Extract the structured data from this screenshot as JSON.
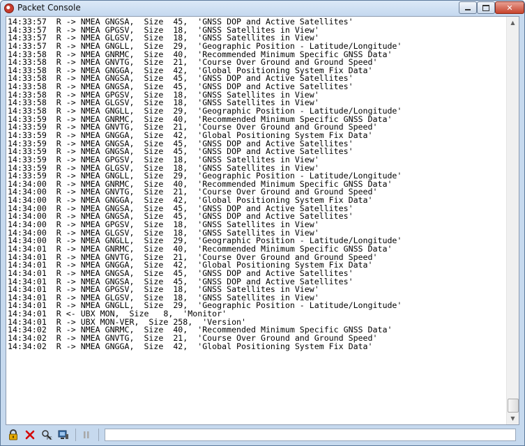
{
  "window": {
    "title": "Packet Console",
    "minimize_label": "",
    "maximize_label": "",
    "close_label": "✕"
  },
  "log": [
    "14:33:57  R -> NMEA GNGSA,  Size  45,  'GNSS DOP and Active Satellites'",
    "14:33:57  R -> NMEA GPGSV,  Size  18,  'GNSS Satellites in View'",
    "14:33:57  R -> NMEA GLGSV,  Size  18,  'GNSS Satellites in View'",
    "14:33:57  R -> NMEA GNGLL,  Size  29,  'Geographic Position - Latitude/Longitude'",
    "14:33:58  R -> NMEA GNRMC,  Size  40,  'Recommended Minimum Specific GNSS Data'",
    "14:33:58  R -> NMEA GNVTG,  Size  21,  'Course Over Ground and Ground Speed'",
    "14:33:58  R -> NMEA GNGGA,  Size  42,  'Global Positioning System Fix Data'",
    "14:33:58  R -> NMEA GNGSA,  Size  45,  'GNSS DOP and Active Satellites'",
    "14:33:58  R -> NMEA GNGSA,  Size  45,  'GNSS DOP and Active Satellites'",
    "14:33:58  R -> NMEA GPGSV,  Size  18,  'GNSS Satellites in View'",
    "14:33:58  R -> NMEA GLGSV,  Size  18,  'GNSS Satellites in View'",
    "14:33:58  R -> NMEA GNGLL,  Size  29,  'Geographic Position - Latitude/Longitude'",
    "14:33:59  R -> NMEA GNRMC,  Size  40,  'Recommended Minimum Specific GNSS Data'",
    "14:33:59  R -> NMEA GNVTG,  Size  21,  'Course Over Ground and Ground Speed'",
    "14:33:59  R -> NMEA GNGGA,  Size  42,  'Global Positioning System Fix Data'",
    "14:33:59  R -> NMEA GNGSA,  Size  45,  'GNSS DOP and Active Satellites'",
    "14:33:59  R -> NMEA GNGSA,  Size  45,  'GNSS DOP and Active Satellites'",
    "14:33:59  R -> NMEA GPGSV,  Size  18,  'GNSS Satellites in View'",
    "14:33:59  R -> NMEA GLGSV,  Size  18,  'GNSS Satellites in View'",
    "14:33:59  R -> NMEA GNGLL,  Size  29,  'Geographic Position - Latitude/Longitude'",
    "14:34:00  R -> NMEA GNRMC,  Size  40,  'Recommended Minimum Specific GNSS Data'",
    "14:34:00  R -> NMEA GNVTG,  Size  21,  'Course Over Ground and Ground Speed'",
    "14:34:00  R -> NMEA GNGGA,  Size  42,  'Global Positioning System Fix Data'",
    "14:34:00  R -> NMEA GNGSA,  Size  45,  'GNSS DOP and Active Satellites'",
    "14:34:00  R -> NMEA GNGSA,  Size  45,  'GNSS DOP and Active Satellites'",
    "14:34:00  R -> NMEA GPGSV,  Size  18,  'GNSS Satellites in View'",
    "14:34:00  R -> NMEA GLGSV,  Size  18,  'GNSS Satellites in View'",
    "14:34:00  R -> NMEA GNGLL,  Size  29,  'Geographic Position - Latitude/Longitude'",
    "14:34:01  R -> NMEA GNRMC,  Size  40,  'Recommended Minimum Specific GNSS Data'",
    "14:34:01  R -> NMEA GNVTG,  Size  21,  'Course Over Ground and Ground Speed'",
    "14:34:01  R -> NMEA GNGGA,  Size  42,  'Global Positioning System Fix Data'",
    "14:34:01  R -> NMEA GNGSA,  Size  45,  'GNSS DOP and Active Satellites'",
    "14:34:01  R -> NMEA GNGSA,  Size  45,  'GNSS DOP and Active Satellites'",
    "14:34:01  R -> NMEA GPGSV,  Size  18,  'GNSS Satellites in View'",
    "14:34:01  R -> NMEA GLGSV,  Size  18,  'GNSS Satellites in View'",
    "14:34:01  R -> NMEA GNGLL,  Size  29,  'Geographic Position - Latitude/Longitude'",
    "14:34:01  R <- UBX MON,  Size   8,  'Monitor'",
    "14:34:01  R -> UBX MON-VER,  Size 258,  'Version'",
    "14:34:02  R -> NMEA GNRMC,  Size  40,  'Recommended Minimum Specific GNSS Data'",
    "14:34:02  R -> NMEA GNVTG,  Size  21,  'Course Over Ground and Ground Speed'",
    "14:34:02  R -> NMEA GNGGA,  Size  42,  'Global Positioning System Fix Data'"
  ],
  "toolbar": {
    "lock_icon": "lock-icon",
    "clear_icon": "clear-x-icon",
    "filter_icon": "filter-pc-icon",
    "capture_icon": "screen-icon",
    "pause_icon": "pause-icon",
    "command_value": ""
  },
  "colors": {
    "frame": "#c6d9ee",
    "close": "#c7432c",
    "clear": "#d40000",
    "lock": "#e3a800"
  }
}
